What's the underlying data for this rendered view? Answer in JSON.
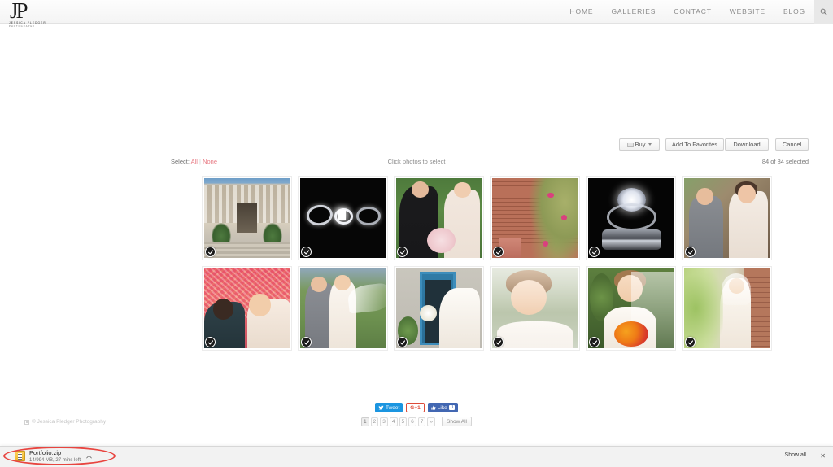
{
  "site": {
    "logo_mark": "JP",
    "logo_sub1": "JESSICA PLEDGER",
    "logo_sub2": "PHOTOGRAPHY",
    "nav": [
      {
        "label": "HOME"
      },
      {
        "label": "GALLERIES"
      },
      {
        "label": "CONTACT"
      },
      {
        "label": "WEBSITE"
      },
      {
        "label": "BLOG"
      }
    ],
    "search_icon": "search-icon"
  },
  "toolbar": {
    "buy_label": "Buy",
    "buy_icon": "cart-icon",
    "buy_caret": "chevron-down-icon",
    "add_to_favorites_label": "Add To Favorites",
    "download_label": "Download",
    "cancel_label": "Cancel"
  },
  "selection": {
    "select_prefix": "Select:",
    "select_all": "All",
    "separator": "|",
    "select_none": "None",
    "hint": "Click photos to select",
    "count": "84 of 84 selected"
  },
  "grid": {
    "rows": [
      [
        {
          "name": "museum-steps-couple",
          "style": "ph-museum",
          "selected": true
        },
        {
          "name": "wedding-rings-black-backdrop",
          "style": "ph-rings-black",
          "selected": true
        },
        {
          "name": "couple-kiss-green-lawn",
          "style": "ph-couple-green",
          "selected": true
        },
        {
          "name": "brick-wall-with-flowers",
          "style": "ph-brick",
          "selected": true
        },
        {
          "name": "diamond-engagement-ring-macro",
          "style": "ph-diamond",
          "selected": true
        },
        {
          "name": "couple-at-ceremony",
          "style": "ph-ceremony",
          "selected": true
        }
      ],
      [
        {
          "name": "kiss-with-pink-confetti",
          "style": "ph-confetti",
          "selected": true
        },
        {
          "name": "couple-with-flowing-veil",
          "style": "ph-veil",
          "selected": true
        },
        {
          "name": "bride-by-blue-door",
          "style": "ph-bluedoor",
          "selected": true
        },
        {
          "name": "bride-looking-down-veil",
          "style": "ph-bridedown",
          "selected": true
        },
        {
          "name": "bride-with-orange-bouquet",
          "style": "ph-bqorange",
          "selected": true
        },
        {
          "name": "bride-near-brick-wall",
          "style": "ph-brideblur",
          "selected": true
        }
      ]
    ],
    "check_icon": "check-icon"
  },
  "social": {
    "tweet_label": "Tweet",
    "tweet_icon": "twitter-bird-icon",
    "gplus_label": "G+1",
    "like_label": "Like",
    "like_icon": "thumbs-up-icon",
    "like_count": "0"
  },
  "pagination": {
    "pages": [
      "1",
      "2",
      "3",
      "4",
      "5",
      "6",
      "7"
    ],
    "active": "1",
    "next_label": "»",
    "show_all_label": "Show All"
  },
  "footer": {
    "copyright": "© Jessica Pledger Photography",
    "broken_image_icon": "broken-image-icon"
  },
  "download_bar": {
    "file_name": "Portfolio.zip",
    "file_status": "14/994 MB, 27 mins left",
    "file_icon": "zip-file-icon",
    "caret_icon": "chevron-up-icon",
    "show_all_label": "Show all",
    "close_icon": "close-icon",
    "annotation": "red-ellipse-highlight"
  },
  "colors": {
    "link_accent": "#e87b84",
    "twitter_blue": "#1b95e0",
    "facebook_blue": "#4267b2",
    "gplus_red": "#dd4b39",
    "annotation_red": "#e8443f"
  }
}
